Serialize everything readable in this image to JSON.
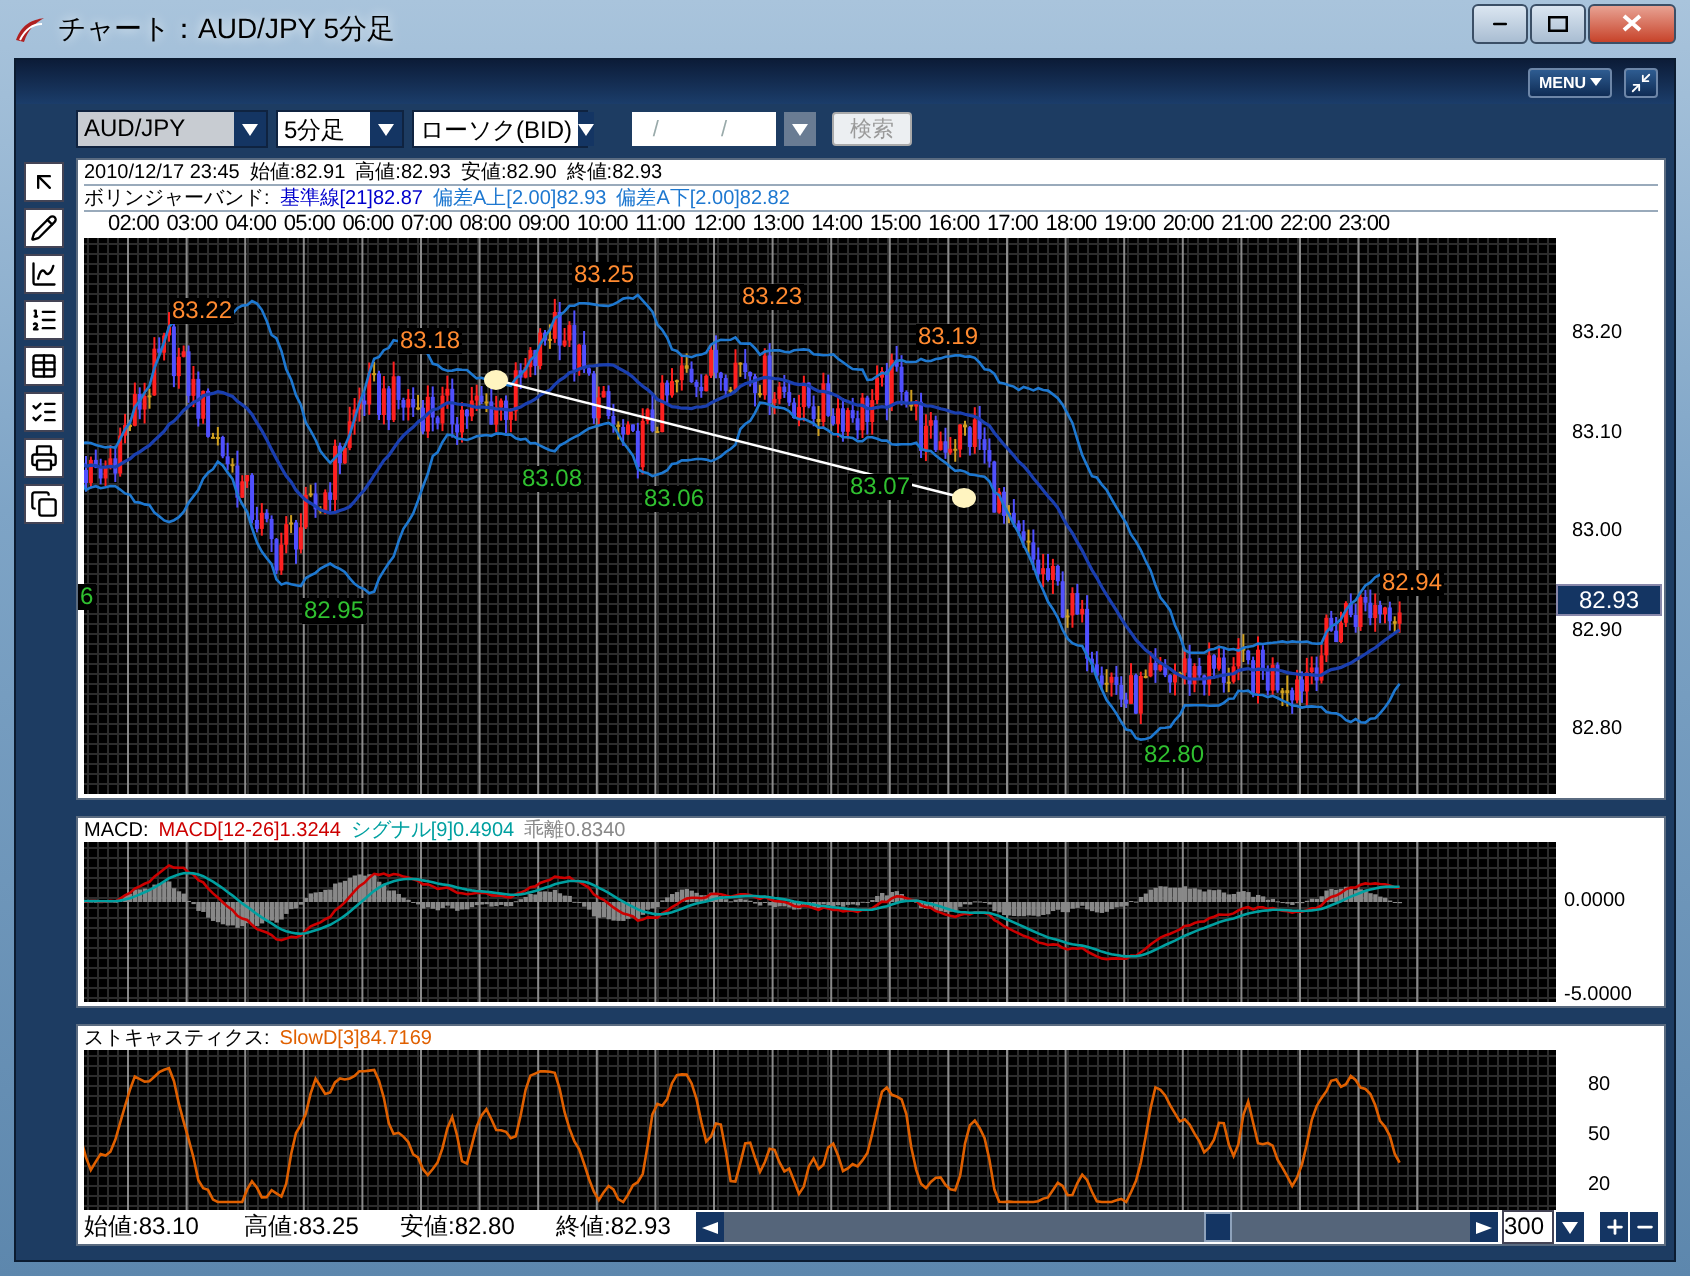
{
  "window": {
    "title": "チャート：AUD/JPY 5分足"
  },
  "menu_button": {
    "label": "MENU"
  },
  "toolbar": {
    "dropdowns": [
      {
        "value": "AUD/JPY",
        "focused": true
      },
      {
        "value": "5分足",
        "focused": false
      },
      {
        "value": "ローソク(BID)",
        "focused": false
      }
    ],
    "date_field": {
      "placeholder": "/ /",
      "disabled": true
    },
    "search_button": {
      "label": "検索",
      "disabled": true
    }
  },
  "price_chart": {
    "info": [
      "2010/12/17 23:45",
      "始値:82.91",
      "高値:82.93",
      "安値:82.90",
      "終値:82.93"
    ],
    "bollinger": {
      "label": "ボリンジャーバンド:",
      "items": [
        {
          "text": "基準線[21]82.87",
          "color": "#0000cc"
        },
        {
          "text": "偏差A上[2.00]82.93",
          "color": "#1e78d0"
        },
        {
          "text": "偏差A下[2.00]82.82",
          "color": "#1e78d0"
        }
      ]
    },
    "times": [
      "02:00",
      "03:00",
      "04:00",
      "05:00",
      "06:00",
      "07:00",
      "08:00",
      "09:00",
      "10:00",
      "11:00",
      "12:00",
      "13:00",
      "14:00",
      "15:00",
      "16:00",
      "17:00",
      "18:00",
      "19:00",
      "20:00",
      "21:00",
      "22:00",
      "23:00"
    ],
    "y_ticks": [
      "83.20",
      "83.10",
      "83.00",
      "82.90",
      "82.80"
    ],
    "current_price": "82.93",
    "annotations": [
      {
        "text": "83.22",
        "kind": "high"
      },
      {
        "text": "83.18",
        "kind": "high"
      },
      {
        "text": "83.25",
        "kind": "high"
      },
      {
        "text": "83.23",
        "kind": "high"
      },
      {
        "text": "83.19",
        "kind": "high"
      },
      {
        "text": "82.94",
        "kind": "high"
      },
      {
        "text": "6",
        "kind": "low"
      },
      {
        "text": "82.95",
        "kind": "low"
      },
      {
        "text": "83.08",
        "kind": "low"
      },
      {
        "text": "83.06",
        "kind": "low"
      },
      {
        "text": "83.07",
        "kind": "low"
      },
      {
        "text": "82.80",
        "kind": "low"
      }
    ]
  },
  "macd": {
    "label": "MACD:",
    "legend": [
      {
        "text": "MACD[12-26]1.3244",
        "color": "#cc0000"
      },
      {
        "text": "シグナル[9]0.4904",
        "color": "#00a0a0"
      },
      {
        "text": "乖離0.8340",
        "color": "#888888"
      }
    ],
    "y_ticks": [
      "0.0000",
      "-5.0000"
    ]
  },
  "stochastic": {
    "label": "ストキャスティクス:",
    "legend": [
      {
        "text": "SlowD[3]84.7169",
        "color": "#e06000"
      }
    ],
    "y_ticks": [
      "80",
      "50",
      "20"
    ]
  },
  "footer": {
    "values": [
      "始値:83.10",
      "高値:83.25",
      "安値:82.80",
      "終値:82.93"
    ],
    "count": "300"
  }
}
